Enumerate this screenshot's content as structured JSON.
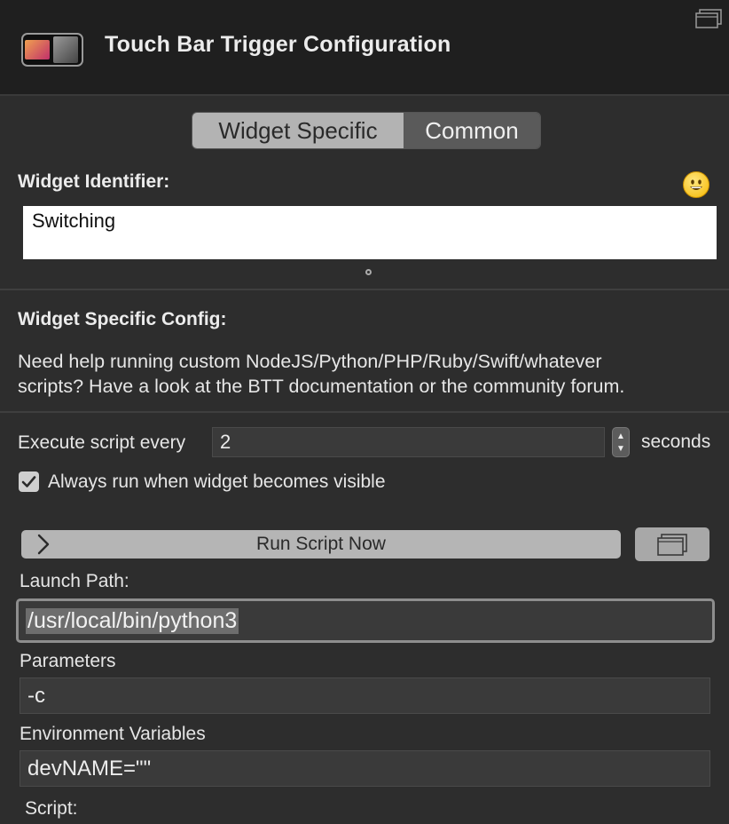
{
  "header": {
    "title": "Touch Bar Trigger Configuration"
  },
  "tabs": {
    "widget_specific": "Widget Specific",
    "common": "Common"
  },
  "identifier": {
    "label": "Widget Identifier:",
    "value": "Switching",
    "emoji": "grinning-face"
  },
  "config": {
    "heading": "Widget Specific Config:",
    "help_line1": "Need help running custom NodeJS/Python/PHP/Ruby/Swift/whatever",
    "help_line2": "scripts? Have a look at the BTT documentation or the community forum."
  },
  "execute": {
    "label": "Execute script every",
    "value": "2",
    "unit": "seconds"
  },
  "always_run": {
    "label": "Always run when widget becomes visible",
    "checked": true
  },
  "run_button": {
    "label": "Run Script Now"
  },
  "launch_path": {
    "label": "Launch Path:",
    "value": "/usr/local/bin/python3"
  },
  "parameters": {
    "label": "Parameters",
    "value": "-c"
  },
  "environment": {
    "label": "Environment Variables",
    "value": "devNAME=\"\""
  },
  "script": {
    "label": "Script:"
  },
  "colors": {
    "background": "#2d2d2d",
    "header": "#1f1f1f",
    "accent_selected": "#b3b3b3"
  }
}
